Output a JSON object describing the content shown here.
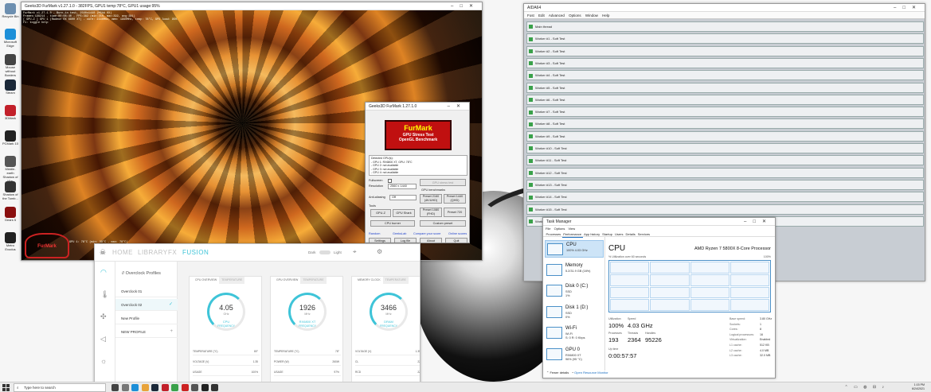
{
  "desktop": {
    "icons": [
      {
        "label": "Recycle Bin",
        "color": "#6d8fb0"
      },
      {
        "label": "Microsoft Edge",
        "color": "#1d8fd8"
      },
      {
        "label": "Mouse without Borders",
        "color": "#444444"
      },
      {
        "label": "Steam",
        "color": "#1b2838"
      },
      {
        "label": "3DMark",
        "color": "#c2202a"
      },
      {
        "label": "PCMark 10",
        "color": "#222222"
      },
      {
        "label": "Middle-earth Shadow of War",
        "color": "#555555"
      },
      {
        "label": "Shadow of the Tomb...",
        "color": "#333333"
      },
      {
        "label": "Gears 5",
        "color": "#8a1010"
      },
      {
        "label": "Metro Exodus",
        "color": "#222222"
      }
    ]
  },
  "furmark": {
    "title": "Geeks3D FurMark v1.27.1.0 - 382FPS, GPU1 temp:78°C, GPU1 usage:95%",
    "osd": "FurMark v1.27.1.0 - Burn-in test, 2560x1440 (MSAA 0X)\nFrames:198214 - time:00:08:40 - FPS:382 (min:350, max:392, avg:381)\n[ GPU-Z ] GPU 1 (Radeon RX 6800 XT) - core: 2340MHz, mem: 1990MHz, temp: 78°C, GPU load: 95%\nF1: toggle help",
    "osd_bottom": "GPU 1: 78°C (min: 39°C - max: 78°C)",
    "logo": "FurMark"
  },
  "furmark_dialog": {
    "title": "Geeks3D FurMark 1.27.1.0",
    "banner_title": "FurMark",
    "banner_sub": "GPU Stress Test",
    "banner_sub2": "OpenGL Benchmark",
    "gpus": "Detected GPU(s):\n- GPU 1: RX6800 XT, GPU: 78°C\n- GPU 2: not available\n- GPU 3: not available\n- GPU 4: not available",
    "fullscreen_label": "Fullscreen",
    "resolution_label": "Resolution",
    "resolution_value": "2560 x 1440",
    "gpu_stress_test": "GPU stress test",
    "aa_label": "Anti-aliasing",
    "aa_value": "Off",
    "benchmarks_label": "GPU benchmarks",
    "preset1": "Preset 2160 (4K/UHD)",
    "preset2": "Preset 1440 (QHD)",
    "preset3": "Preset 1080 (FHD)",
    "preset4": "Preset 720",
    "tools_label": "Tools",
    "gpuz": "GPU-Z",
    "gpushark": "GPU Shark",
    "cpuburner": "CPU burner",
    "custom": "Custom preset",
    "link1": "Random",
    "link2": "GeeksLab",
    "link3": "Compare your score",
    "link4": "Online scores",
    "settings": "Settings",
    "logfile": "Log file",
    "about": "About",
    "quit": "Quit"
  },
  "aida": {
    "title": "AIDA64",
    "menu": [
      "Fost",
      "Edit",
      "Advanced",
      "Options",
      "Window",
      "Help"
    ],
    "rows": [
      "Main thread",
      "Worker #1 - Soft Test",
      "Worker #2 - Soft Test",
      "Worker #3 - Soft Test",
      "Worker #4 - Soft Test",
      "Worker #5 - Soft Test",
      "Worker #6 - Soft Test",
      "Worker #7 - Soft Test",
      "Worker #8 - Soft Test",
      "Worker #9 - Soft Test",
      "Worker #10 - Soft Test",
      "Worker #11 - Soft Test",
      "Worker #12 - Soft Test",
      "Worker #13 - Soft Test",
      "Worker #14 - Soft Test",
      "Worker #15 - Soft Test",
      "Worker #16 - Soft Test"
    ]
  },
  "taskmgr": {
    "title": "Task Manager",
    "menu": [
      "File",
      "Options",
      "View"
    ],
    "tabs": [
      "Processes",
      "Performance",
      "App history",
      "Startup",
      "Users",
      "Details",
      "Services"
    ],
    "active_tab": 1,
    "side": [
      {
        "name": "CPU",
        "v1": "100% 4.03 GHz",
        "v2": ""
      },
      {
        "name": "Memory",
        "v1": "5.2/31.9 GB (16%)",
        "v2": ""
      },
      {
        "name": "Disk 0 (C:)",
        "v1": "SSD",
        "v2": "1%"
      },
      {
        "name": "Disk 1 (D:)",
        "v1": "SSD",
        "v2": "0%"
      },
      {
        "name": "Wi-Fi",
        "v1": "Wi-Fi",
        "v2": "S: 0 R: 0 Kbps"
      },
      {
        "name": "GPU 0",
        "v1": "RX6800 XT",
        "v2": "96% (95 °C)"
      }
    ],
    "cpu_label": "CPU",
    "cpu_name": "AMD Ryzen 7 5800X 8-Core Processor",
    "graph_caption": "% Utilization over 60 seconds",
    "graph_max": "100%",
    "utilization_label": "Utilization",
    "utilization": "100%",
    "speed_label": "Speed",
    "speed": "4.03 GHz",
    "processes_label": "Processes",
    "processes": "193",
    "threads_label": "Threads",
    "threads": "2364",
    "handles_label": "Handles",
    "handles": "95226",
    "uptime_label": "Up time",
    "uptime": "0:00:57:57",
    "specs": [
      {
        "k": "Base speed:",
        "v": "3.80 GHz"
      },
      {
        "k": "Sockets:",
        "v": "1"
      },
      {
        "k": "Cores:",
        "v": "8"
      },
      {
        "k": "Logical processors:",
        "v": "16"
      },
      {
        "k": "Virtualization:",
        "v": "Enabled"
      },
      {
        "k": "L1 cache:",
        "v": "512 KB"
      },
      {
        "k": "L2 cache:",
        "v": "4.0 MB"
      },
      {
        "k": "L3 cache:",
        "v": "32.0 MB"
      }
    ],
    "fewer": "Fewer details",
    "monitor": "Open Resource Monitor"
  },
  "cam": {
    "nav": [
      "HOME",
      "LIBRARY",
      "FX",
      "FUSION"
    ],
    "active_nav": 3,
    "theme_dark": "Dark",
    "theme_light": "Light",
    "profiles_title": "// Overclock Profiles",
    "profiles": [
      "Overclock 01",
      "Overclock 02",
      "New Profile",
      "NEW PROFILE"
    ],
    "cards": [
      {
        "tab_a": "CPU OVERVIEW",
        "tab_b": "TEMPERATURE",
        "value": "4.05",
        "unit": "GHz",
        "sub": "CPU",
        "cap": "FREQUENCY",
        "rows": [
          {
            "k": "TEMPERATURE (°C)",
            "v": "80°"
          },
          {
            "k": "VOLTAGE (V)",
            "v": "1.35"
          },
          {
            "k": "USAGE",
            "v": "100%"
          }
        ]
      },
      {
        "tab_a": "GPU OVERVIEW",
        "tab_b": "TEMPERATURE",
        "value": "1926",
        "unit": "MHz",
        "sub": "RX6800 XT",
        "cap": "FREQUENCY",
        "rows": [
          {
            "k": "TEMPERATURE (°C)",
            "v": "78°"
          },
          {
            "k": "POWER (W)",
            "v": "260W"
          },
          {
            "k": "USAGE",
            "v": "97%"
          }
        ]
      },
      {
        "tab_a": "MEMORY CLOCK",
        "tab_b": "TEMPERATURE",
        "value": "3466",
        "unit": "MHz",
        "sub": "DRAM",
        "cap": "FREQUENCY",
        "rows": [
          {
            "k": "VOLTAGE (V)",
            "v": "1.35"
          },
          {
            "k": "CL",
            "v": "22"
          },
          {
            "k": "RCD",
            "v": "22"
          }
        ]
      }
    ]
  },
  "taskbar": {
    "search_placeholder": "Type here to search",
    "time": "1:15 PM",
    "date": "6/24/2021"
  }
}
